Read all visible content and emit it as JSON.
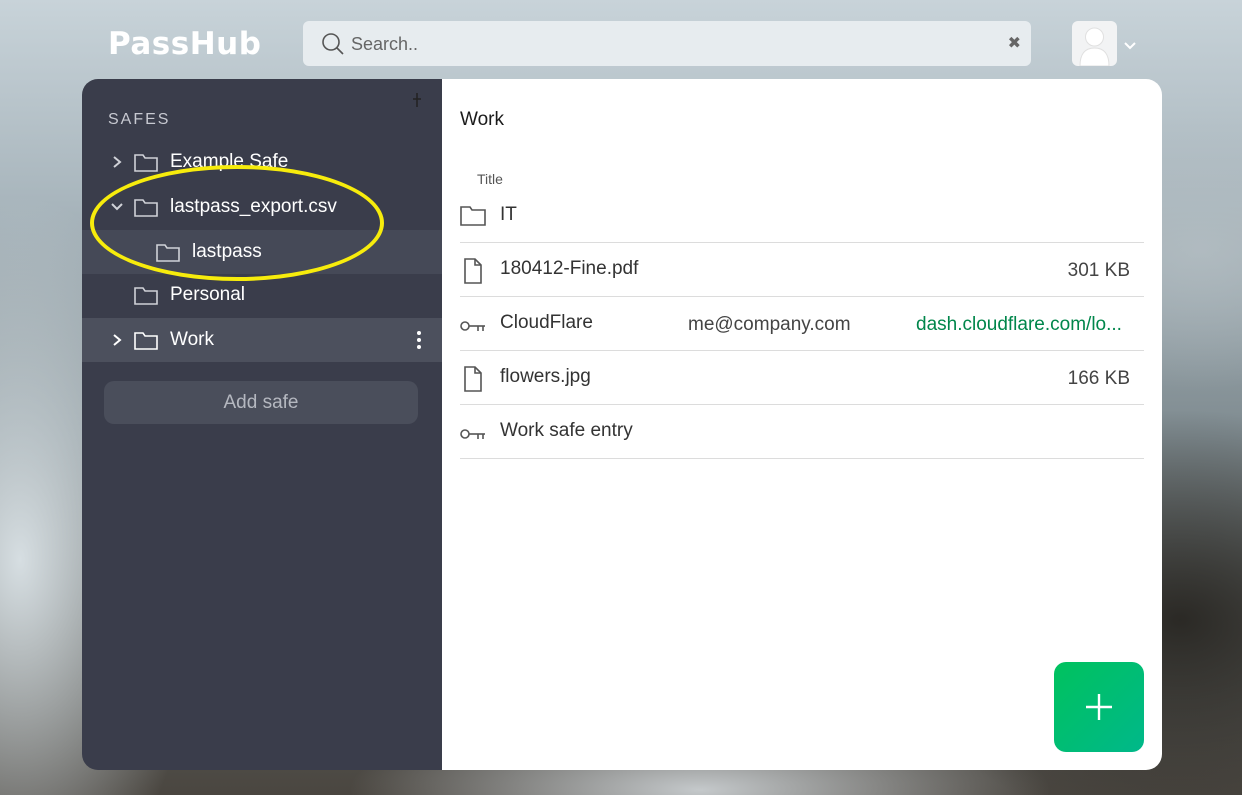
{
  "header": {
    "logo_text": "PassHub",
    "search": {
      "placeholder": "Search..",
      "value": ""
    }
  },
  "sidebar": {
    "title": "SAFES",
    "safes": [
      {
        "label": "Example Safe",
        "state": "collapsed"
      },
      {
        "label": "lastpass_export.csv",
        "state": "expanded"
      },
      {
        "label": "lastpass",
        "state": "child"
      },
      {
        "label": "Personal",
        "state": "none"
      },
      {
        "label": "Work",
        "state": "collapsed-selected"
      }
    ],
    "add_safe_label": "Add safe"
  },
  "main": {
    "safe_name": "Work",
    "column_title": "Title",
    "items": [
      {
        "type": "folder-icon",
        "title": "IT",
        "username": "",
        "link": "",
        "size": ""
      },
      {
        "type": "file-icon",
        "title": "180412-Fine.pdf",
        "username": "",
        "link": "",
        "size": "301 KB"
      },
      {
        "type": "key-icon",
        "title": "CloudFlare",
        "username": "me@company.com",
        "link": "dash.cloudflare.com/lo...",
        "size": ""
      },
      {
        "type": "file-icon",
        "title": "flowers.jpg",
        "username": "",
        "link": "",
        "size": "166 KB"
      },
      {
        "type": "key-icon",
        "title": "Work safe entry",
        "username": "",
        "link": "",
        "size": ""
      }
    ]
  },
  "colors": {
    "sidebar_bg": "#3a3d4b",
    "accent_green": "#00c25e",
    "link_green": "#00864b",
    "highlight_yellow": "#f7ec0c"
  }
}
